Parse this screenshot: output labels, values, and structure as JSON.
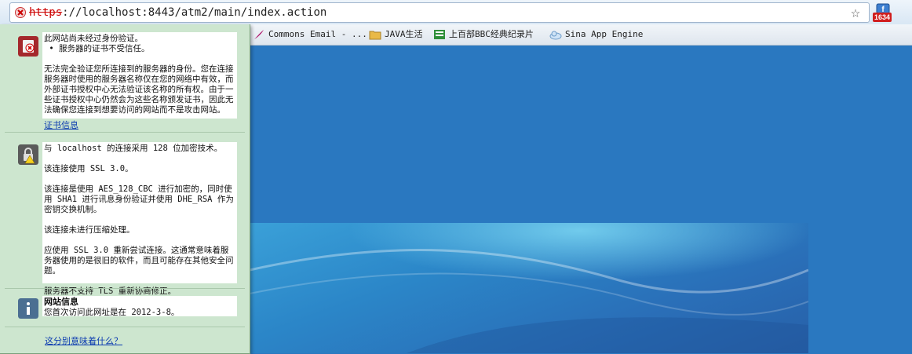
{
  "address_bar": {
    "scheme": "https",
    "rest": "://localhost:8443/atm2/main/index.action",
    "star_icon": "star-icon",
    "extension_badge": "1634"
  },
  "bookmarks": [
    {
      "label": "Commons Email - ...",
      "icon": "feather-icon"
    },
    {
      "label": "JAVA生活",
      "icon": "folder-icon"
    },
    {
      "label": "上百部BBC经典纪录片",
      "icon": "page-icon"
    },
    {
      "label": "Sina App Engine",
      "icon": "cloud-icon"
    }
  ],
  "security_popup": {
    "identity": {
      "line1": "此网站尚未经过身份验证。",
      "line2": " • 服务器的证书不受信任。",
      "para": "无法完全验证您所连接到的服务器的身份。您在连接服务器时使用的服务器名称仅在您的网络中有效，而外部证书授权中心无法验证该名称的所有权。由于一些证书授权中心仍然会为这些名称颁发证书，因此无法确保您连接到想要访问的网站而不是攻击网站。",
      "cert_link": "证书信息"
    },
    "connection": {
      "p1": "与 localhost 的连接采用 128 位加密技术。",
      "p2": "该连接使用 SSL 3.0。",
      "p3": "该连接是使用 AES_128_CBC 进行加密的，同时使用 SHA1 进行讯息身份验证并使用 DHE_RSA 作为密钥交换机制。",
      "p4": "该连接未进行压缩处理。",
      "p5": "应使用 SSL 3.0 重新尝试连接。这通常意味着服务器使用的是很旧的软件，而且可能存在其他安全问题。",
      "p6": "服务器不支持 TLS 重新协商修正。"
    },
    "site_info": {
      "title": "网站信息",
      "text": "您首次访问此网址是在 2012-3-8。"
    },
    "help_link": "这分别意味着什么？"
  }
}
